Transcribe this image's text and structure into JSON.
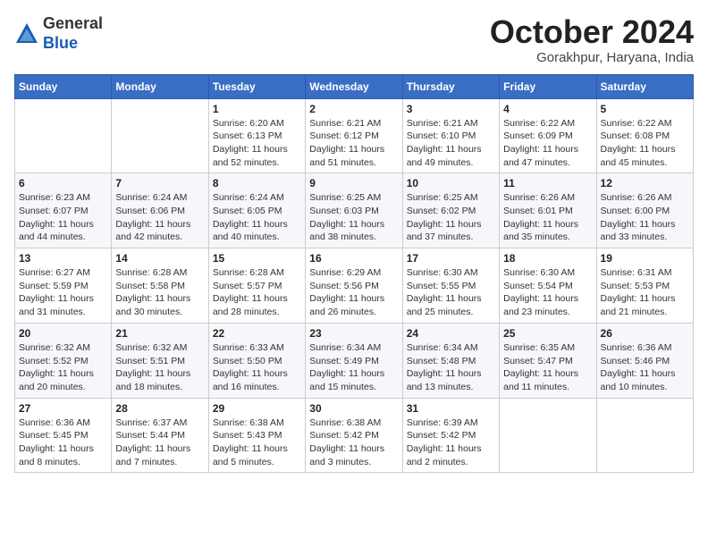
{
  "logo": {
    "general": "General",
    "blue": "Blue"
  },
  "title": "October 2024",
  "location": "Gorakhpur, Haryana, India",
  "days_header": [
    "Sunday",
    "Monday",
    "Tuesday",
    "Wednesday",
    "Thursday",
    "Friday",
    "Saturday"
  ],
  "weeks": [
    [
      {
        "day": "",
        "info": ""
      },
      {
        "day": "",
        "info": ""
      },
      {
        "day": "1",
        "info": "Sunrise: 6:20 AM\nSunset: 6:13 PM\nDaylight: 11 hours and 52 minutes."
      },
      {
        "day": "2",
        "info": "Sunrise: 6:21 AM\nSunset: 6:12 PM\nDaylight: 11 hours and 51 minutes."
      },
      {
        "day": "3",
        "info": "Sunrise: 6:21 AM\nSunset: 6:10 PM\nDaylight: 11 hours and 49 minutes."
      },
      {
        "day": "4",
        "info": "Sunrise: 6:22 AM\nSunset: 6:09 PM\nDaylight: 11 hours and 47 minutes."
      },
      {
        "day": "5",
        "info": "Sunrise: 6:22 AM\nSunset: 6:08 PM\nDaylight: 11 hours and 45 minutes."
      }
    ],
    [
      {
        "day": "6",
        "info": "Sunrise: 6:23 AM\nSunset: 6:07 PM\nDaylight: 11 hours and 44 minutes."
      },
      {
        "day": "7",
        "info": "Sunrise: 6:24 AM\nSunset: 6:06 PM\nDaylight: 11 hours and 42 minutes."
      },
      {
        "day": "8",
        "info": "Sunrise: 6:24 AM\nSunset: 6:05 PM\nDaylight: 11 hours and 40 minutes."
      },
      {
        "day": "9",
        "info": "Sunrise: 6:25 AM\nSunset: 6:03 PM\nDaylight: 11 hours and 38 minutes."
      },
      {
        "day": "10",
        "info": "Sunrise: 6:25 AM\nSunset: 6:02 PM\nDaylight: 11 hours and 37 minutes."
      },
      {
        "day": "11",
        "info": "Sunrise: 6:26 AM\nSunset: 6:01 PM\nDaylight: 11 hours and 35 minutes."
      },
      {
        "day": "12",
        "info": "Sunrise: 6:26 AM\nSunset: 6:00 PM\nDaylight: 11 hours and 33 minutes."
      }
    ],
    [
      {
        "day": "13",
        "info": "Sunrise: 6:27 AM\nSunset: 5:59 PM\nDaylight: 11 hours and 31 minutes."
      },
      {
        "day": "14",
        "info": "Sunrise: 6:28 AM\nSunset: 5:58 PM\nDaylight: 11 hours and 30 minutes."
      },
      {
        "day": "15",
        "info": "Sunrise: 6:28 AM\nSunset: 5:57 PM\nDaylight: 11 hours and 28 minutes."
      },
      {
        "day": "16",
        "info": "Sunrise: 6:29 AM\nSunset: 5:56 PM\nDaylight: 11 hours and 26 minutes."
      },
      {
        "day": "17",
        "info": "Sunrise: 6:30 AM\nSunset: 5:55 PM\nDaylight: 11 hours and 25 minutes."
      },
      {
        "day": "18",
        "info": "Sunrise: 6:30 AM\nSunset: 5:54 PM\nDaylight: 11 hours and 23 minutes."
      },
      {
        "day": "19",
        "info": "Sunrise: 6:31 AM\nSunset: 5:53 PM\nDaylight: 11 hours and 21 minutes."
      }
    ],
    [
      {
        "day": "20",
        "info": "Sunrise: 6:32 AM\nSunset: 5:52 PM\nDaylight: 11 hours and 20 minutes."
      },
      {
        "day": "21",
        "info": "Sunrise: 6:32 AM\nSunset: 5:51 PM\nDaylight: 11 hours and 18 minutes."
      },
      {
        "day": "22",
        "info": "Sunrise: 6:33 AM\nSunset: 5:50 PM\nDaylight: 11 hours and 16 minutes."
      },
      {
        "day": "23",
        "info": "Sunrise: 6:34 AM\nSunset: 5:49 PM\nDaylight: 11 hours and 15 minutes."
      },
      {
        "day": "24",
        "info": "Sunrise: 6:34 AM\nSunset: 5:48 PM\nDaylight: 11 hours and 13 minutes."
      },
      {
        "day": "25",
        "info": "Sunrise: 6:35 AM\nSunset: 5:47 PM\nDaylight: 11 hours and 11 minutes."
      },
      {
        "day": "26",
        "info": "Sunrise: 6:36 AM\nSunset: 5:46 PM\nDaylight: 11 hours and 10 minutes."
      }
    ],
    [
      {
        "day": "27",
        "info": "Sunrise: 6:36 AM\nSunset: 5:45 PM\nDaylight: 11 hours and 8 minutes."
      },
      {
        "day": "28",
        "info": "Sunrise: 6:37 AM\nSunset: 5:44 PM\nDaylight: 11 hours and 7 minutes."
      },
      {
        "day": "29",
        "info": "Sunrise: 6:38 AM\nSunset: 5:43 PM\nDaylight: 11 hours and 5 minutes."
      },
      {
        "day": "30",
        "info": "Sunrise: 6:38 AM\nSunset: 5:42 PM\nDaylight: 11 hours and 3 minutes."
      },
      {
        "day": "31",
        "info": "Sunrise: 6:39 AM\nSunset: 5:42 PM\nDaylight: 11 hours and 2 minutes."
      },
      {
        "day": "",
        "info": ""
      },
      {
        "day": "",
        "info": ""
      }
    ]
  ]
}
